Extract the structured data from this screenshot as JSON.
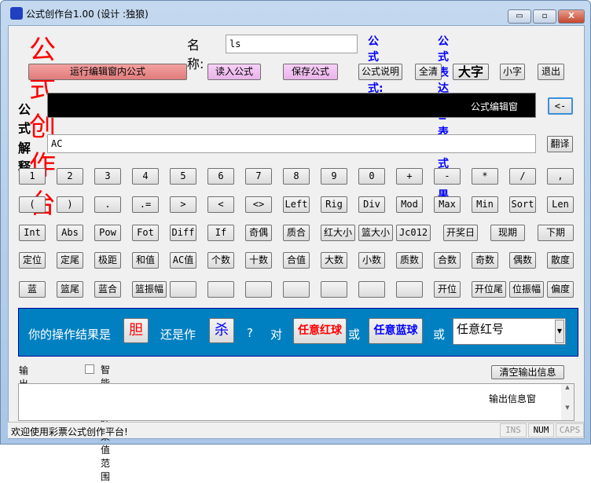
{
  "window": {
    "title": "公式创作台1.00 (设计 :独狼)",
    "minimize": "▭",
    "maximize": "▫",
    "close": "X"
  },
  "header": {
    "app_title": "公式创作台",
    "name_label": "名称:",
    "name_value": "ls",
    "format_label": "公式格式:",
    "format_text": "公式表达式=表达式结果"
  },
  "toolbar": {
    "run": "运行编辑窗内公式",
    "load": "读入公式",
    "save": "保存公式",
    "help": "公式说明",
    "clear_all": "全清",
    "big_font": "大字",
    "small_font": "小字",
    "exit": "退出"
  },
  "formula": {
    "label": "公式",
    "editor_hint": "公式编辑窗",
    "back": "<-"
  },
  "explain": {
    "label": "解释",
    "value": "AC",
    "translate": "翻译"
  },
  "keypad": [
    [
      "1",
      "2",
      "3",
      "4",
      "5",
      "6",
      "7",
      "8",
      "9",
      "0",
      "+",
      "-",
      "*",
      "/",
      ","
    ],
    [
      "(",
      ")",
      ".",
      ".=",
      ">",
      "<",
      "<>",
      "Left",
      "Rig",
      "Div",
      "Mod",
      "Max",
      "Min",
      "Sort",
      "Len"
    ],
    [
      "Int",
      "Abs",
      "Pow",
      "Fot",
      "Diff",
      "If",
      "奇偶",
      "质合",
      "红大小",
      "篮大小",
      "Jc012",
      "开奖日",
      "现期",
      "下期"
    ],
    [
      "定位",
      "定尾",
      "极距",
      "和值",
      "AC值",
      "个数",
      "十数",
      "合值",
      "大数",
      "小数",
      "质数",
      "合数",
      "奇数",
      "偶数",
      "散度"
    ],
    [
      "蓝",
      "篮尾",
      "蓝合",
      "篮振幅",
      "",
      "",
      "",
      "",
      "",
      "",
      "",
      "开位",
      "开位尾",
      "位振幅",
      "偏度"
    ]
  ],
  "result_panel": {
    "text1": "你的操作结果是",
    "dan": "胆",
    "text2": "还是作",
    "sha": "杀",
    "q": "?",
    "text3": "对",
    "red_ball": "任意红球",
    "or1": "或",
    "blue_ball": "任意蓝球",
    "or2": "或",
    "select_value": "任意红号",
    "bg": "#0080c0"
  },
  "output": {
    "label": "输出结果:",
    "checkbox_label": "智能控制结果值范围",
    "checked": false,
    "clear": "清空输出信息",
    "hint": "输出信息窗"
  },
  "status": {
    "message": "欢迎使用彩票公式创作平台!",
    "ins": "INS",
    "num": "NUM",
    "caps": "CAPS"
  }
}
